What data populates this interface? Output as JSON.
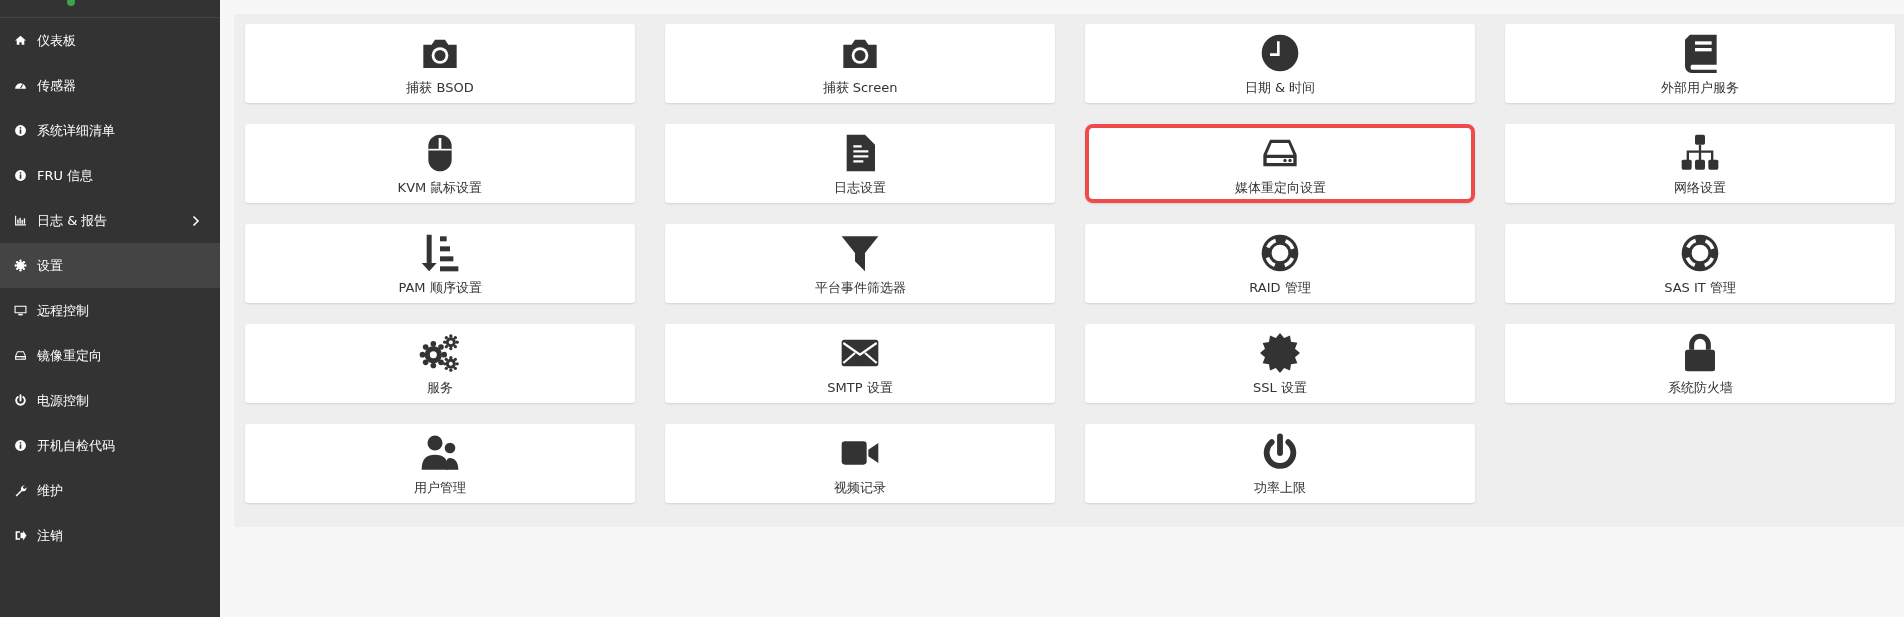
{
  "sidebar": {
    "status": {
      "color": "#3fa34d"
    },
    "items": [
      {
        "label": "仪表板",
        "kind": "home",
        "selected": false,
        "has_submenu": false
      },
      {
        "label": "传感器",
        "kind": "gauge",
        "selected": false,
        "has_submenu": false
      },
      {
        "label": "系统详细清单",
        "kind": "info",
        "selected": false,
        "has_submenu": false
      },
      {
        "label": "FRU 信息",
        "kind": "info",
        "selected": false,
        "has_submenu": false
      },
      {
        "label": "日志 & 报告",
        "kind": "chart",
        "selected": false,
        "has_submenu": true
      },
      {
        "label": "设置",
        "kind": "gear",
        "selected": true,
        "has_submenu": false
      },
      {
        "label": "远程控制",
        "kind": "monitor",
        "selected": false,
        "has_submenu": false
      },
      {
        "label": "镜像重定向",
        "kind": "drive",
        "selected": false,
        "has_submenu": false
      },
      {
        "label": "电源控制",
        "kind": "power",
        "selected": false,
        "has_submenu": false
      },
      {
        "label": "开机自检代码",
        "kind": "info",
        "selected": false,
        "has_submenu": false
      },
      {
        "label": "维护",
        "kind": "wrench",
        "selected": false,
        "has_submenu": false
      },
      {
        "label": "注销",
        "kind": "signout",
        "selected": false,
        "has_submenu": false
      }
    ]
  },
  "tiles": [
    {
      "label": "捕获 BSOD",
      "kind": "camera",
      "highlighted": false
    },
    {
      "label": "捕获 Screen",
      "kind": "camera",
      "highlighted": false
    },
    {
      "label": "日期 & 时间",
      "kind": "clock",
      "highlighted": false
    },
    {
      "label": "外部用户服务",
      "kind": "book",
      "highlighted": false
    },
    {
      "label": "KVM 鼠标设置",
      "kind": "mouse",
      "highlighted": false
    },
    {
      "label": "日志设置",
      "kind": "file",
      "highlighted": false
    },
    {
      "label": "媒体重定向设置",
      "kind": "drive",
      "highlighted": true
    },
    {
      "label": "网络设置",
      "kind": "sitemap",
      "highlighted": false
    },
    {
      "label": "PAM 顺序设置",
      "kind": "sort",
      "highlighted": false
    },
    {
      "label": "平台事件筛选器",
      "kind": "filter",
      "highlighted": false
    },
    {
      "label": "RAID 管理",
      "kind": "lifering",
      "highlighted": false
    },
    {
      "label": "SAS IT 管理",
      "kind": "lifering",
      "highlighted": false
    },
    {
      "label": "服务",
      "kind": "gears",
      "highlighted": false
    },
    {
      "label": "SMTP 设置",
      "kind": "envelope",
      "highlighted": false
    },
    {
      "label": "SSL 设置",
      "kind": "certificate",
      "highlighted": false
    },
    {
      "label": "系统防火墙",
      "kind": "lock",
      "highlighted": false
    },
    {
      "label": "用户管理",
      "kind": "users",
      "highlighted": false
    },
    {
      "label": "视频记录",
      "kind": "video",
      "highlighted": false
    },
    {
      "label": "功率上限",
      "kind": "power",
      "highlighted": false
    }
  ]
}
